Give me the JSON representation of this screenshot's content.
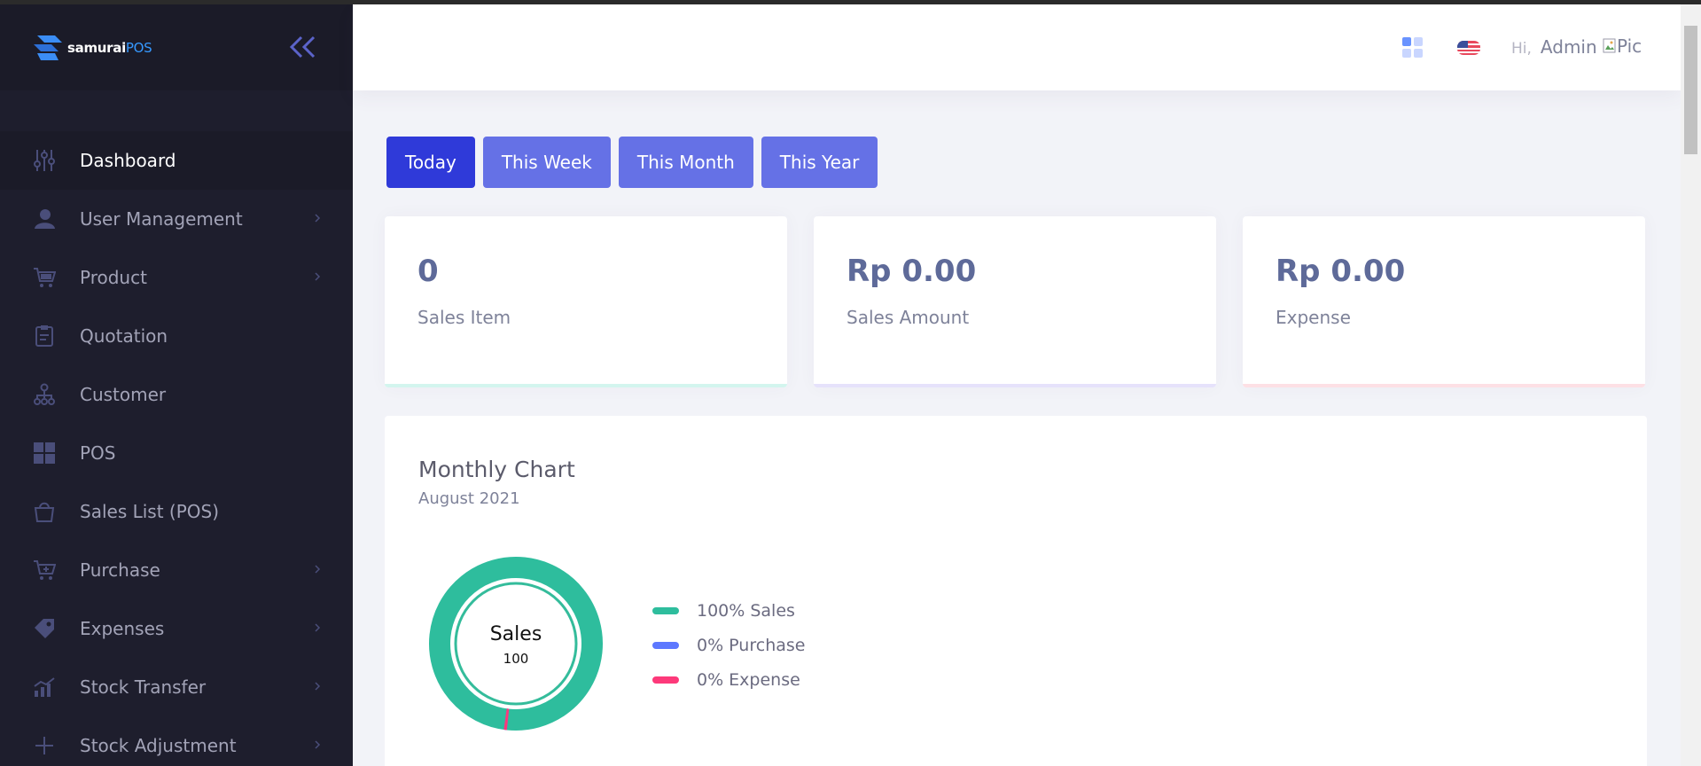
{
  "brand": {
    "name": "samurai",
    "suffix": "POS"
  },
  "sidebar": {
    "items": [
      {
        "label": "Dashboard",
        "icon": "sliders-icon",
        "active": true,
        "has_submenu": false
      },
      {
        "label": "User Management",
        "icon": "user-icon",
        "active": false,
        "has_submenu": true
      },
      {
        "label": "Product",
        "icon": "cart-icon",
        "active": false,
        "has_submenu": true
      },
      {
        "label": "Quotation",
        "icon": "clipboard-icon",
        "active": false,
        "has_submenu": false
      },
      {
        "label": "Customer",
        "icon": "network-icon",
        "active": false,
        "has_submenu": false
      },
      {
        "label": "POS",
        "icon": "grid-icon",
        "active": false,
        "has_submenu": false
      },
      {
        "label": "Sales List (POS)",
        "icon": "bag-icon",
        "active": false,
        "has_submenu": false
      },
      {
        "label": "Purchase",
        "icon": "cart-add-icon",
        "active": false,
        "has_submenu": true
      },
      {
        "label": "Expenses",
        "icon": "tag-icon",
        "active": false,
        "has_submenu": true
      },
      {
        "label": "Stock Transfer",
        "icon": "chart-bars-icon",
        "active": false,
        "has_submenu": true
      },
      {
        "label": "Stock Adjustment",
        "icon": "plus-icon",
        "active": false,
        "has_submenu": true
      }
    ]
  },
  "header": {
    "greeting": "Hi,",
    "username": "Admin",
    "avatar_alt": "Pic"
  },
  "filters": [
    {
      "label": "Today",
      "active": true
    },
    {
      "label": "This Week",
      "active": false
    },
    {
      "label": "This Month",
      "active": false
    },
    {
      "label": "This Year",
      "active": false
    }
  ],
  "stats": [
    {
      "value": "0",
      "label": "Sales Item",
      "color": "#1bc5bd"
    },
    {
      "value": "Rp 0.00",
      "label": "Sales Amount",
      "color": "#8950fc"
    },
    {
      "value": "Rp 0.00",
      "label": "Expense",
      "color": "#f64e60"
    }
  ],
  "chart_data": {
    "type": "pie",
    "title": "Monthly Chart",
    "subtitle": "August 2021",
    "center_label": "Sales",
    "center_value": "100",
    "series": [
      {
        "name": "Sales",
        "value": 100,
        "legend": "100% Sales",
        "color": "#2ebd9d"
      },
      {
        "name": "Purchase",
        "value": 0,
        "legend": "0% Purchase",
        "color": "#5d78ff"
      },
      {
        "name": "Expense",
        "value": 0,
        "legend": "0% Expense",
        "color": "#fd397a"
      }
    ]
  },
  "colors": {
    "sidebar_bg": "#1e1e2d",
    "accent": "#6571e6",
    "accent_active": "#2f3ad9",
    "page_bg": "#f2f3f8"
  }
}
